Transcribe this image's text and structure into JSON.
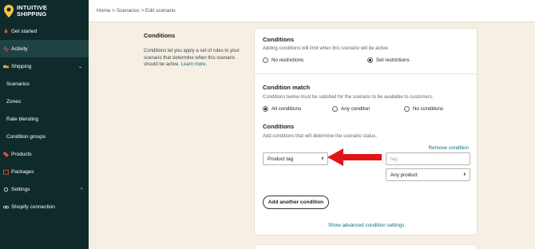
{
  "brand": {
    "line1": "INTUITIVE",
    "line2": "SHIPPING",
    "accent": "#f5c542"
  },
  "sidebar": {
    "items": [
      {
        "label": "Get started",
        "icon": "rocket-icon"
      },
      {
        "label": "Activity",
        "icon": "activity-icon"
      },
      {
        "label": "Shipping",
        "icon": "truck-icon"
      },
      {
        "label": "Scenarios"
      },
      {
        "label": "Zones"
      },
      {
        "label": "Rate blending"
      },
      {
        "label": "Condition groups"
      },
      {
        "label": "Products",
        "icon": "tag-icon"
      },
      {
        "label": "Packages",
        "icon": "package-icon"
      },
      {
        "label": "Settings",
        "icon": "gear-icon"
      },
      {
        "label": "Shopify connection",
        "icon": "link-icon"
      }
    ]
  },
  "breadcrumb": "Home > Scenarios > Edit scenario",
  "desc": {
    "title": "Conditions",
    "text": "Conditions let you apply a set of rules to your scenario that determine when this scenario should be active.",
    "link": "Learn more."
  },
  "card": {
    "conditions_title": "Conditions",
    "conditions_sub": "Adding conditions will limit when this scenario will be active.",
    "opt_no_restrictions": "No restrictions",
    "opt_set_restrictions": "Set restrictions",
    "match_title": "Condition match",
    "match_sub": "Conditions below must be satisfied for the scenario to be available to customers.",
    "opt_all": "All conditions",
    "opt_any": "Any conditon",
    "opt_none": "No conditions",
    "conds_title": "Conditions",
    "conds_sub": "Add conditions that will determine the scenario status.",
    "remove_link": "Remove condition",
    "product_tag_select": "Product tag",
    "tag_placeholder": "tag",
    "any_product_select": "Any product",
    "add_button": "Add another condition",
    "advanced_link": "Show advanced condition settings"
  },
  "colors": {
    "sidebar_bg": "#0f2a2b",
    "arrow": "#e0151a",
    "link": "#0a6e7e"
  }
}
